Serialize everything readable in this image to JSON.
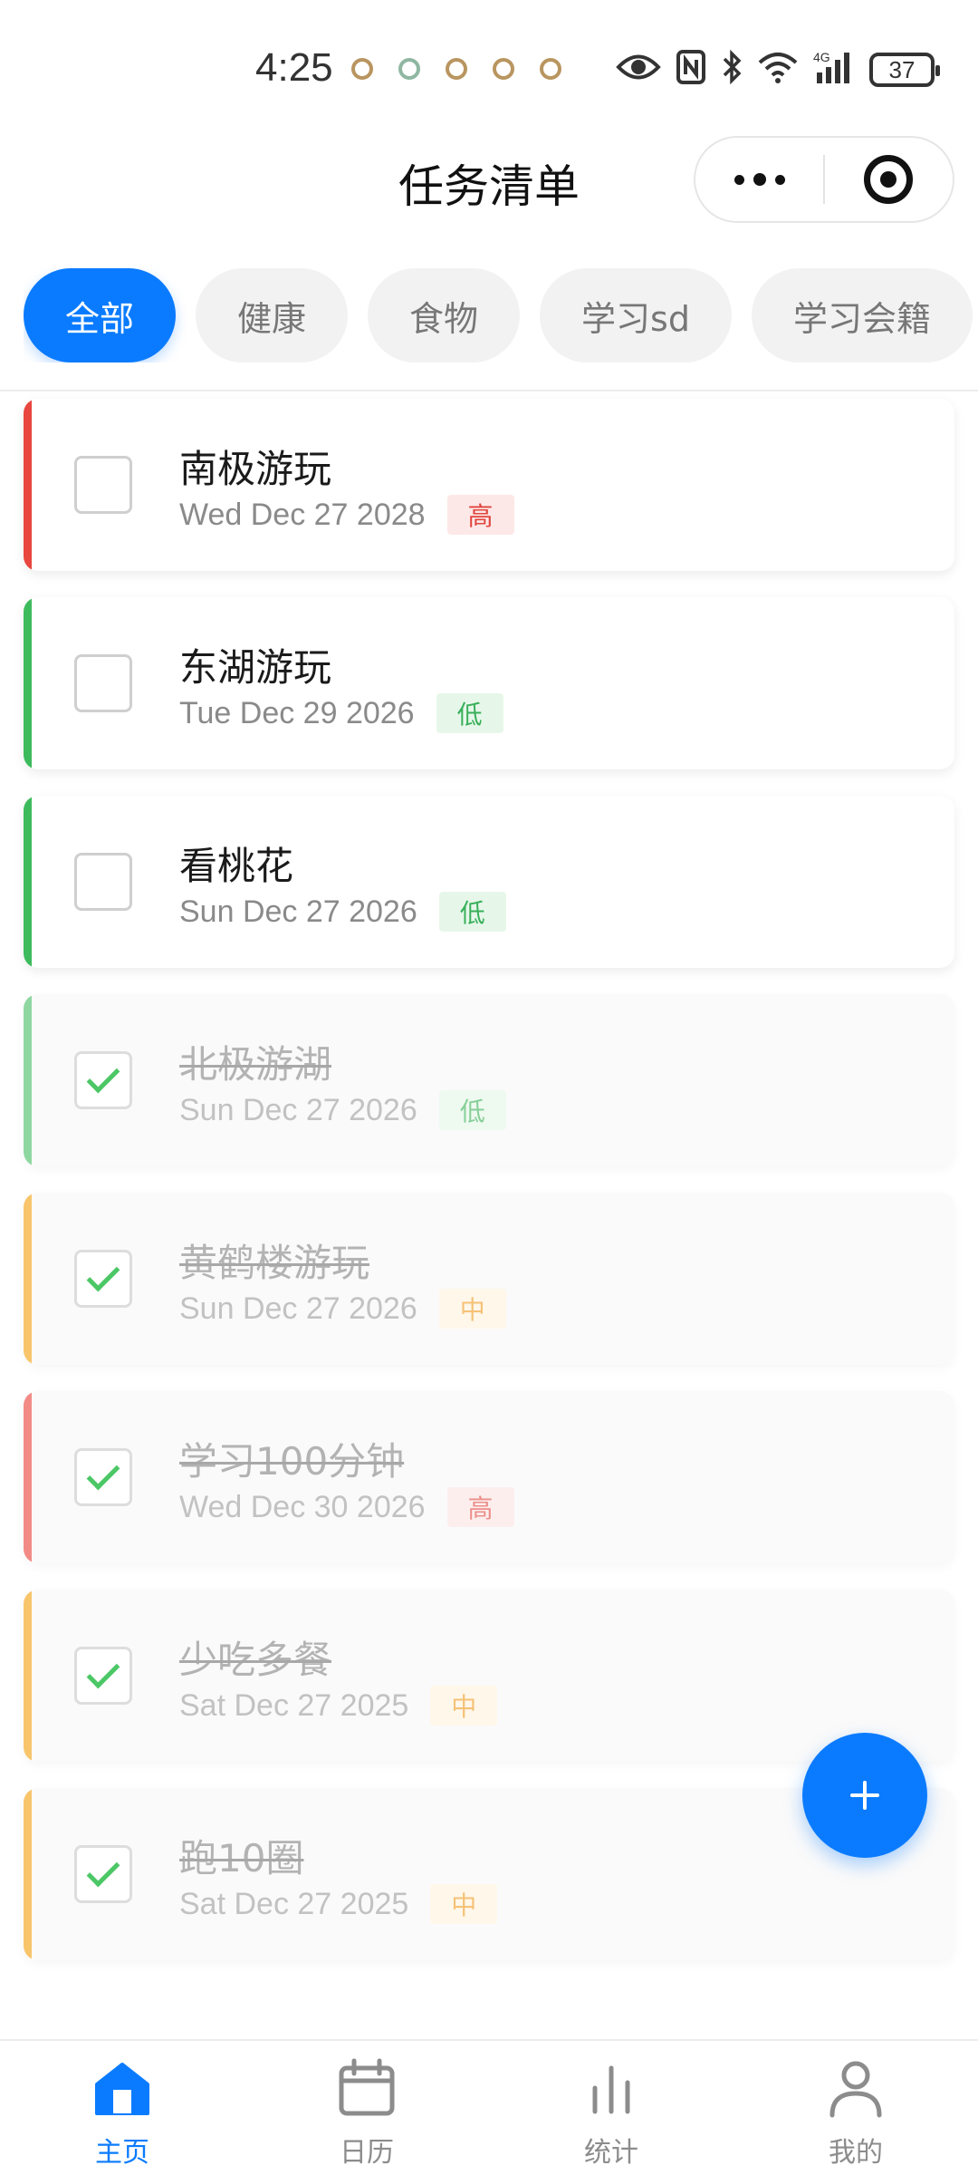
{
  "status_bar": {
    "time": "4:25",
    "network": "4G",
    "battery": "37"
  },
  "nav": {
    "title": "任务清单"
  },
  "categories": [
    {
      "label": "全部",
      "active": true
    },
    {
      "label": "健康",
      "active": false
    },
    {
      "label": "食物",
      "active": false
    },
    {
      "label": "学习sd",
      "active": false
    },
    {
      "label": "学习会籍",
      "active": false
    }
  ],
  "tasks": [
    {
      "title": "南极游玩",
      "date": "Wed Dec 27 2028",
      "priority": "高",
      "done": false
    },
    {
      "title": "东湖游玩",
      "date": "Tue Dec 29 2026",
      "priority": "低",
      "done": false
    },
    {
      "title": "看桃花",
      "date": "Sun Dec 27 2026",
      "priority": "低",
      "done": false
    },
    {
      "title": "北极游湖",
      "date": "Sun Dec 27 2026",
      "priority": "低",
      "done": true
    },
    {
      "title": "黄鹤楼游玩",
      "date": "Sun Dec 27 2026",
      "priority": "中",
      "done": true
    },
    {
      "title": "学习100分钟",
      "date": "Wed Dec 30 2026",
      "priority": "高",
      "done": true
    },
    {
      "title": "少吃多餐",
      "date": "Sat Dec 27 2025",
      "priority": "中",
      "done": true
    },
    {
      "title": "跑10圈",
      "date": "Sat Dec 27 2025",
      "priority": "中",
      "done": true
    }
  ],
  "priority_colors": {
    "高": "#e0453d",
    "中": "#f2a43a",
    "低": "#3ab05a"
  },
  "fab": {
    "icon": "plus-icon"
  },
  "tabbar": [
    {
      "label": "主页",
      "icon": "home-icon",
      "active": true
    },
    {
      "label": "日历",
      "icon": "calendar-icon",
      "active": false
    },
    {
      "label": "统计",
      "icon": "bar-chart-icon",
      "active": false
    },
    {
      "label": "我的",
      "icon": "user-icon",
      "active": false
    }
  ],
  "colors": {
    "accent": "#0a7bff"
  }
}
